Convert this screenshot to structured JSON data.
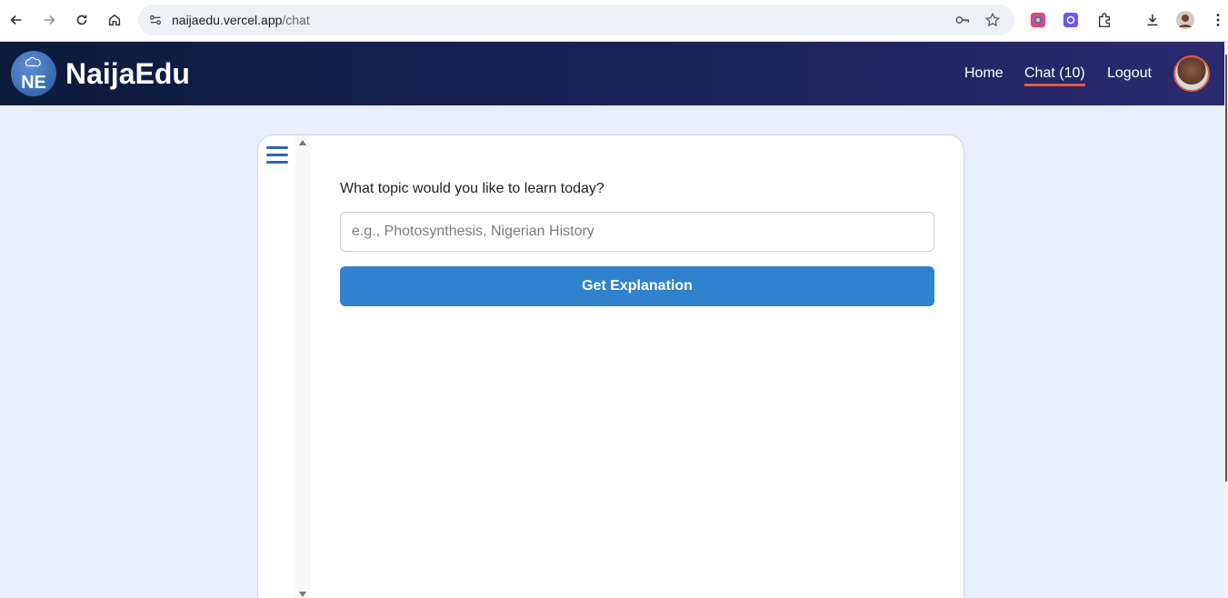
{
  "browser": {
    "url_host": "naijaedu.vercel.app",
    "url_path": "/chat"
  },
  "header": {
    "logo_text": "NE",
    "brand": "NaijaEdu",
    "nav": [
      {
        "label": "Home"
      },
      {
        "label": "Chat (10)"
      },
      {
        "label": "Logout"
      }
    ]
  },
  "main": {
    "prompt": "What topic would you like to learn today?",
    "topic_placeholder": "e.g., Photosynthesis, Nigerian History",
    "submit_label": "Get Explanation"
  },
  "colors": {
    "accent": "#3182ce",
    "nav_underline": "#e05a47",
    "header_start": "#0b1b3a",
    "header_end": "#2a2a6e"
  }
}
